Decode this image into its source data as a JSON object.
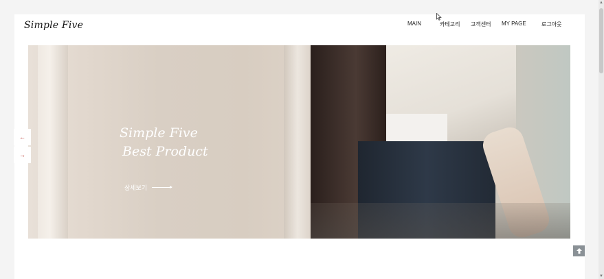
{
  "header": {
    "logo": "Simple Five",
    "nav": [
      {
        "key": "main",
        "label": "MAIN"
      },
      {
        "key": "category",
        "label": "카테고리"
      },
      {
        "key": "support",
        "label": "고객센터"
      },
      {
        "key": "mypage",
        "label": "MY PAGE"
      },
      {
        "key": "logout",
        "label": "로그아웃"
      }
    ]
  },
  "hero": {
    "title_line1": "Simple Five",
    "title_line2": "Best Product",
    "detail_label": "상세보기",
    "prev_icon": "arrow-left-icon",
    "next_icon": "arrow-right-icon"
  },
  "scroll_top_icon": "arrow-up-icon",
  "colors": {
    "accent": "#b3261e",
    "top_button": "#8a9196",
    "background": "#f4f4f4"
  }
}
